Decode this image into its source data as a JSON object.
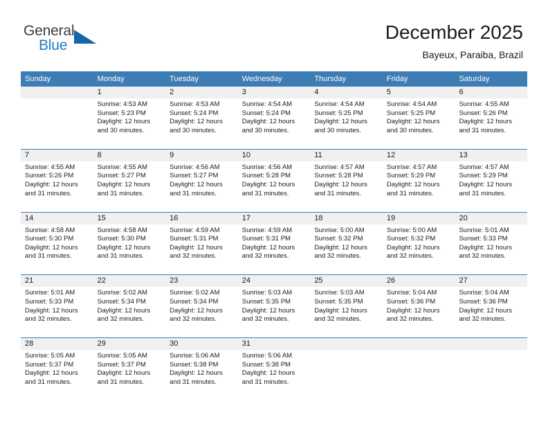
{
  "brand": {
    "name_part1": "General",
    "name_part2": "Blue",
    "triangle_icon": "triangle-icon",
    "accent_color": "#1e7bc4",
    "header_color": "#3e7cb5"
  },
  "header": {
    "title": "December 2025",
    "subtitle": "Bayeux, Paraiba, Brazil"
  },
  "calendar": {
    "weekday_headers": [
      "Sunday",
      "Monday",
      "Tuesday",
      "Wednesday",
      "Thursday",
      "Friday",
      "Saturday"
    ],
    "weeks": [
      [
        {
          "day": "",
          "empty": true,
          "sunrise": "",
          "sunset": "",
          "daylight_line1": "",
          "daylight_line2": ""
        },
        {
          "day": "1",
          "empty": false,
          "sunrise": "Sunrise: 4:53 AM",
          "sunset": "Sunset: 5:23 PM",
          "daylight_line1": "Daylight: 12 hours",
          "daylight_line2": "and 30 minutes."
        },
        {
          "day": "2",
          "empty": false,
          "sunrise": "Sunrise: 4:53 AM",
          "sunset": "Sunset: 5:24 PM",
          "daylight_line1": "Daylight: 12 hours",
          "daylight_line2": "and 30 minutes."
        },
        {
          "day": "3",
          "empty": false,
          "sunrise": "Sunrise: 4:54 AM",
          "sunset": "Sunset: 5:24 PM",
          "daylight_line1": "Daylight: 12 hours",
          "daylight_line2": "and 30 minutes."
        },
        {
          "day": "4",
          "empty": false,
          "sunrise": "Sunrise: 4:54 AM",
          "sunset": "Sunset: 5:25 PM",
          "daylight_line1": "Daylight: 12 hours",
          "daylight_line2": "and 30 minutes."
        },
        {
          "day": "5",
          "empty": false,
          "sunrise": "Sunrise: 4:54 AM",
          "sunset": "Sunset: 5:25 PM",
          "daylight_line1": "Daylight: 12 hours",
          "daylight_line2": "and 30 minutes."
        },
        {
          "day": "6",
          "empty": false,
          "sunrise": "Sunrise: 4:55 AM",
          "sunset": "Sunset: 5:26 PM",
          "daylight_line1": "Daylight: 12 hours",
          "daylight_line2": "and 31 minutes."
        }
      ],
      [
        {
          "day": "7",
          "empty": false,
          "sunrise": "Sunrise: 4:55 AM",
          "sunset": "Sunset: 5:26 PM",
          "daylight_line1": "Daylight: 12 hours",
          "daylight_line2": "and 31 minutes."
        },
        {
          "day": "8",
          "empty": false,
          "sunrise": "Sunrise: 4:55 AM",
          "sunset": "Sunset: 5:27 PM",
          "daylight_line1": "Daylight: 12 hours",
          "daylight_line2": "and 31 minutes."
        },
        {
          "day": "9",
          "empty": false,
          "sunrise": "Sunrise: 4:56 AM",
          "sunset": "Sunset: 5:27 PM",
          "daylight_line1": "Daylight: 12 hours",
          "daylight_line2": "and 31 minutes."
        },
        {
          "day": "10",
          "empty": false,
          "sunrise": "Sunrise: 4:56 AM",
          "sunset": "Sunset: 5:28 PM",
          "daylight_line1": "Daylight: 12 hours",
          "daylight_line2": "and 31 minutes."
        },
        {
          "day": "11",
          "empty": false,
          "sunrise": "Sunrise: 4:57 AM",
          "sunset": "Sunset: 5:28 PM",
          "daylight_line1": "Daylight: 12 hours",
          "daylight_line2": "and 31 minutes."
        },
        {
          "day": "12",
          "empty": false,
          "sunrise": "Sunrise: 4:57 AM",
          "sunset": "Sunset: 5:29 PM",
          "daylight_line1": "Daylight: 12 hours",
          "daylight_line2": "and 31 minutes."
        },
        {
          "day": "13",
          "empty": false,
          "sunrise": "Sunrise: 4:57 AM",
          "sunset": "Sunset: 5:29 PM",
          "daylight_line1": "Daylight: 12 hours",
          "daylight_line2": "and 31 minutes."
        }
      ],
      [
        {
          "day": "14",
          "empty": false,
          "sunrise": "Sunrise: 4:58 AM",
          "sunset": "Sunset: 5:30 PM",
          "daylight_line1": "Daylight: 12 hours",
          "daylight_line2": "and 31 minutes."
        },
        {
          "day": "15",
          "empty": false,
          "sunrise": "Sunrise: 4:58 AM",
          "sunset": "Sunset: 5:30 PM",
          "daylight_line1": "Daylight: 12 hours",
          "daylight_line2": "and 31 minutes."
        },
        {
          "day": "16",
          "empty": false,
          "sunrise": "Sunrise: 4:59 AM",
          "sunset": "Sunset: 5:31 PM",
          "daylight_line1": "Daylight: 12 hours",
          "daylight_line2": "and 32 minutes."
        },
        {
          "day": "17",
          "empty": false,
          "sunrise": "Sunrise: 4:59 AM",
          "sunset": "Sunset: 5:31 PM",
          "daylight_line1": "Daylight: 12 hours",
          "daylight_line2": "and 32 minutes."
        },
        {
          "day": "18",
          "empty": false,
          "sunrise": "Sunrise: 5:00 AM",
          "sunset": "Sunset: 5:32 PM",
          "daylight_line1": "Daylight: 12 hours",
          "daylight_line2": "and 32 minutes."
        },
        {
          "day": "19",
          "empty": false,
          "sunrise": "Sunrise: 5:00 AM",
          "sunset": "Sunset: 5:32 PM",
          "daylight_line1": "Daylight: 12 hours",
          "daylight_line2": "and 32 minutes."
        },
        {
          "day": "20",
          "empty": false,
          "sunrise": "Sunrise: 5:01 AM",
          "sunset": "Sunset: 5:33 PM",
          "daylight_line1": "Daylight: 12 hours",
          "daylight_line2": "and 32 minutes."
        }
      ],
      [
        {
          "day": "21",
          "empty": false,
          "sunrise": "Sunrise: 5:01 AM",
          "sunset": "Sunset: 5:33 PM",
          "daylight_line1": "Daylight: 12 hours",
          "daylight_line2": "and 32 minutes."
        },
        {
          "day": "22",
          "empty": false,
          "sunrise": "Sunrise: 5:02 AM",
          "sunset": "Sunset: 5:34 PM",
          "daylight_line1": "Daylight: 12 hours",
          "daylight_line2": "and 32 minutes."
        },
        {
          "day": "23",
          "empty": false,
          "sunrise": "Sunrise: 5:02 AM",
          "sunset": "Sunset: 5:34 PM",
          "daylight_line1": "Daylight: 12 hours",
          "daylight_line2": "and 32 minutes."
        },
        {
          "day": "24",
          "empty": false,
          "sunrise": "Sunrise: 5:03 AM",
          "sunset": "Sunset: 5:35 PM",
          "daylight_line1": "Daylight: 12 hours",
          "daylight_line2": "and 32 minutes."
        },
        {
          "day": "25",
          "empty": false,
          "sunrise": "Sunrise: 5:03 AM",
          "sunset": "Sunset: 5:35 PM",
          "daylight_line1": "Daylight: 12 hours",
          "daylight_line2": "and 32 minutes."
        },
        {
          "day": "26",
          "empty": false,
          "sunrise": "Sunrise: 5:04 AM",
          "sunset": "Sunset: 5:36 PM",
          "daylight_line1": "Daylight: 12 hours",
          "daylight_line2": "and 32 minutes."
        },
        {
          "day": "27",
          "empty": false,
          "sunrise": "Sunrise: 5:04 AM",
          "sunset": "Sunset: 5:36 PM",
          "daylight_line1": "Daylight: 12 hours",
          "daylight_line2": "and 32 minutes."
        }
      ],
      [
        {
          "day": "28",
          "empty": false,
          "sunrise": "Sunrise: 5:05 AM",
          "sunset": "Sunset: 5:37 PM",
          "daylight_line1": "Daylight: 12 hours",
          "daylight_line2": "and 31 minutes."
        },
        {
          "day": "29",
          "empty": false,
          "sunrise": "Sunrise: 5:05 AM",
          "sunset": "Sunset: 5:37 PM",
          "daylight_line1": "Daylight: 12 hours",
          "daylight_line2": "and 31 minutes."
        },
        {
          "day": "30",
          "empty": false,
          "sunrise": "Sunrise: 5:06 AM",
          "sunset": "Sunset: 5:38 PM",
          "daylight_line1": "Daylight: 12 hours",
          "daylight_line2": "and 31 minutes."
        },
        {
          "day": "31",
          "empty": false,
          "sunrise": "Sunrise: 5:06 AM",
          "sunset": "Sunset: 5:38 PM",
          "daylight_line1": "Daylight: 12 hours",
          "daylight_line2": "and 31 minutes."
        },
        {
          "day": "",
          "empty": true,
          "sunrise": "",
          "sunset": "",
          "daylight_line1": "",
          "daylight_line2": ""
        },
        {
          "day": "",
          "empty": true,
          "sunrise": "",
          "sunset": "",
          "daylight_line1": "",
          "daylight_line2": ""
        },
        {
          "day": "",
          "empty": true,
          "sunrise": "",
          "sunset": "",
          "daylight_line1": "",
          "daylight_line2": ""
        }
      ]
    ]
  }
}
